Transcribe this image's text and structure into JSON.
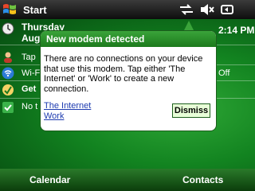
{
  "topbar": {
    "start_label": "Start",
    "time": "2:14 PM"
  },
  "today": {
    "date_line1": "Thursday",
    "date_line2": "Aug",
    "owner_text": "Tap",
    "wifi_text": "Wi-Fi",
    "wifi_status": "Off",
    "getting_started": "Get",
    "tasks_text": "No t"
  },
  "notification": {
    "title": "New modem detected",
    "body": "There are no connections on your device that use this modem. Tap either 'The Internet' or 'Work' to create a new connection.",
    "link_label": "The Internet Work",
    "dismiss_label": "Dismiss"
  },
  "softkeys": {
    "left": "Calendar",
    "right": "Contacts"
  },
  "colors": {
    "accent": "#1c7a1c",
    "link": "#1d3bb0"
  }
}
